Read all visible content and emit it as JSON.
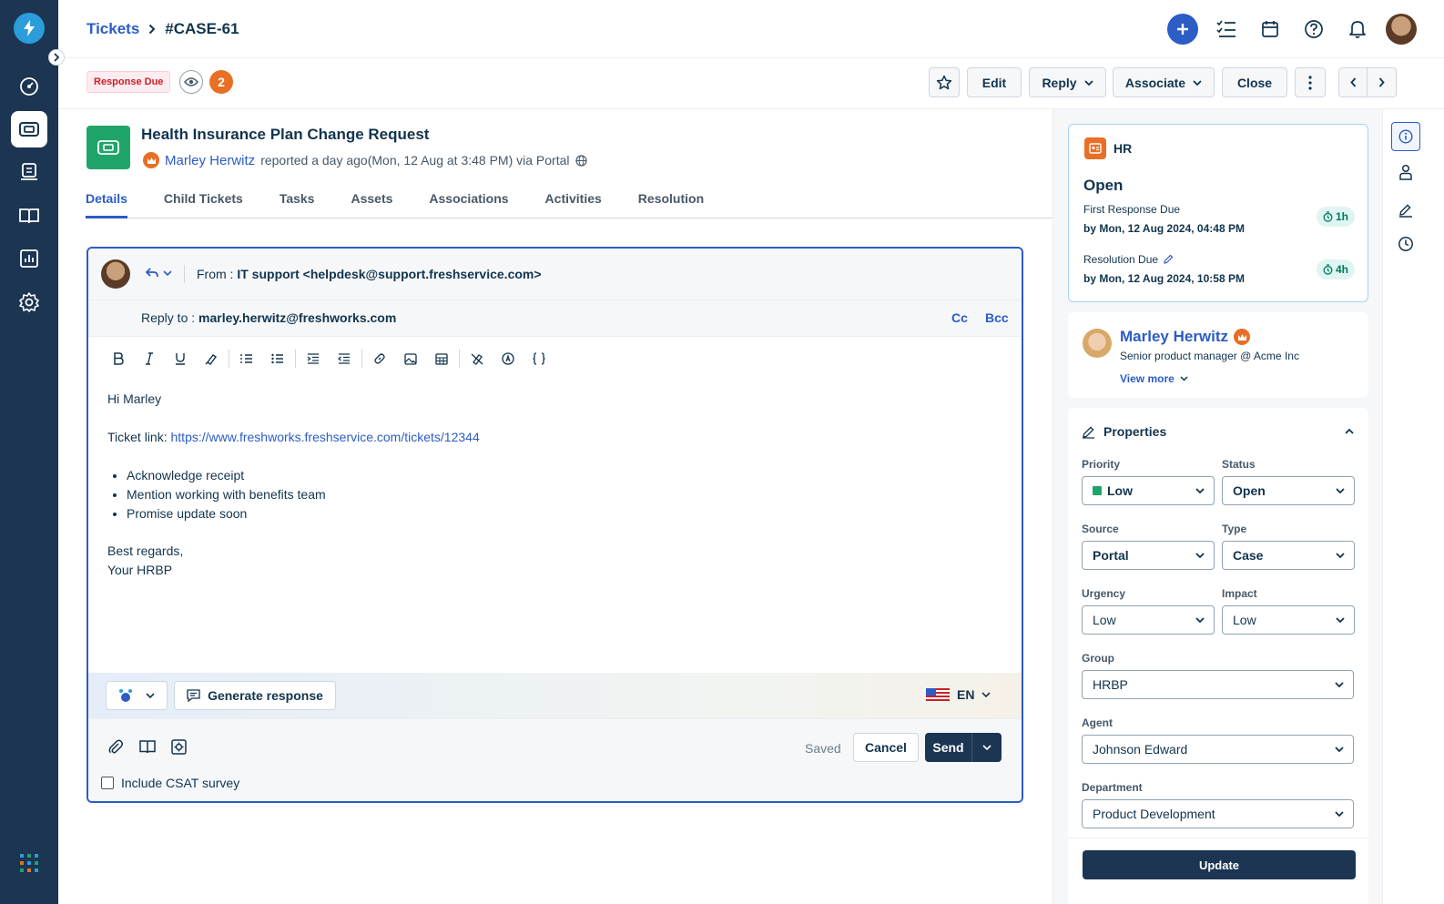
{
  "header": {
    "breadcrumb_root": "Tickets",
    "breadcrumb_current": "#CASE-61"
  },
  "actions": {
    "due_badge": "Response Due",
    "viewer_count": "2",
    "edit": "Edit",
    "reply": "Reply",
    "associate": "Associate",
    "close": "Close"
  },
  "ticket": {
    "title": "Health Insurance Plan Change Request",
    "requester": "Marley Herwitz",
    "reported_text": "reported a day ago(Mon, 12 Aug at 3:48 PM) via Portal"
  },
  "tabs": [
    "Details",
    "Child Tickets",
    "Tasks",
    "Assets",
    "Associations",
    "Activities",
    "Resolution"
  ],
  "composer": {
    "from_label": "From :",
    "from_value": "IT support <helpdesk@support.freshservice.com>",
    "reply_to_label": "Reply to :",
    "reply_to_value": "marley.herwitz@freshworks.com",
    "cc": "Cc",
    "bcc": "Bcc",
    "greeting": "Hi Marley",
    "link_label": "Ticket link:",
    "link_url": "https://www.freshworks.freshservice.com/tickets/12344",
    "bullets": [
      "Acknowledge receipt",
      "Mention working with benefits team",
      "Promise update soon"
    ],
    "signoff": "Best regards,",
    "signature": "Your HRBP",
    "generate": "Generate response",
    "lang": "EN",
    "saved": "Saved",
    "cancel": "Cancel",
    "send": "Send",
    "csat": "Include CSAT survey"
  },
  "sla": {
    "workspace": "HR",
    "status": "Open",
    "first_response_label": "First Response Due",
    "first_response_value": "by Mon, 12 Aug 2024, 04:48 PM",
    "first_response_timer": "1h",
    "resolution_label": "Resolution Due",
    "resolution_value": "by Mon, 12 Aug 2024, 10:58 PM",
    "resolution_timer": "4h"
  },
  "requester_card": {
    "name": "Marley Herwitz",
    "title": "Senior product manager @ Acme Inc",
    "view_more": "View more"
  },
  "properties": {
    "heading": "Properties",
    "priority_label": "Priority",
    "priority": "Low",
    "status_label": "Status",
    "status": "Open",
    "source_label": "Source",
    "source": "Portal",
    "type_label": "Type",
    "type": "Case",
    "urgency_label": "Urgency",
    "urgency": "Low",
    "impact_label": "Impact",
    "impact": "Low",
    "group_label": "Group",
    "group": "HRBP",
    "agent_label": "Agent",
    "agent": "Johnson Edward",
    "department_label": "Department",
    "department": "Product Development",
    "update": "Update"
  },
  "colors": {
    "nav_bg": "#1b3552",
    "accent": "#2c5cc5",
    "ticket_icon": "#1fa56a",
    "priority_low": "#1fa56a",
    "badge_orange": "#e86f25"
  }
}
